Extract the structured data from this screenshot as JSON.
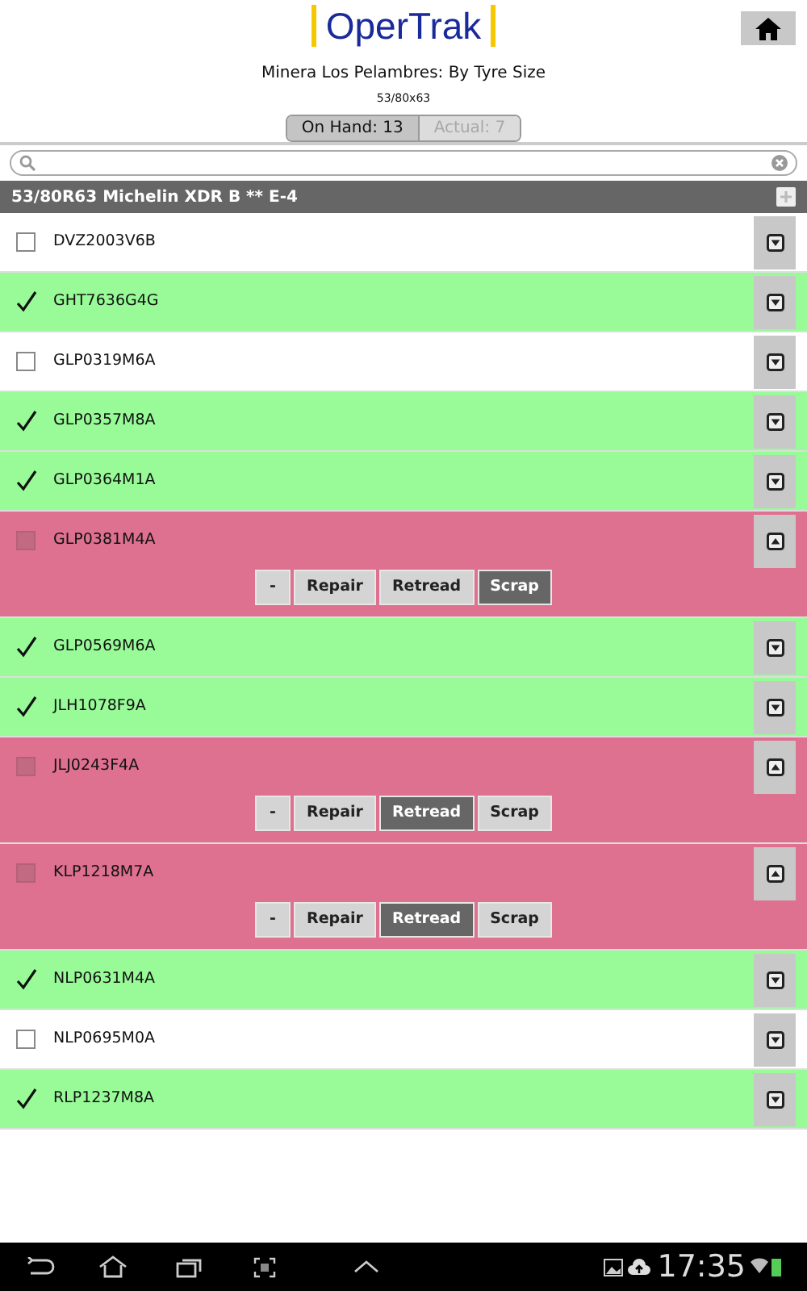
{
  "header": {
    "logo": "OperTrak",
    "title": "Minera Los Pelambres: By Tyre Size",
    "subtitle": "53/80x63"
  },
  "segments": [
    {
      "label": "On Hand: 13",
      "selected": true
    },
    {
      "label": "Actual: 7",
      "selected": false
    }
  ],
  "group": {
    "title": "53/80R63 Michelin XDR B ** E-4"
  },
  "rows": [
    {
      "id": "DVZ2003V6B",
      "kind": "open",
      "expanded": false
    },
    {
      "id": "GHT7636G4G",
      "kind": "done",
      "expanded": false
    },
    {
      "id": "GLP0319M6A",
      "kind": "open",
      "expanded": false
    },
    {
      "id": "GLP0357M8A",
      "kind": "done",
      "expanded": false
    },
    {
      "id": "GLP0364M1A",
      "kind": "done",
      "expanded": false
    },
    {
      "id": "GLP0381M4A",
      "kind": "flagged",
      "expanded": true,
      "actions": [
        {
          "label": "-",
          "selected": false
        },
        {
          "label": "Repair",
          "selected": false
        },
        {
          "label": "Retread",
          "selected": false
        },
        {
          "label": "Scrap",
          "selected": true
        }
      ]
    },
    {
      "id": "GLP0569M6A",
      "kind": "done",
      "expanded": false
    },
    {
      "id": "JLH1078F9A",
      "kind": "done",
      "expanded": false
    },
    {
      "id": "JLJ0243F4A",
      "kind": "flagged",
      "expanded": true,
      "actions": [
        {
          "label": "-",
          "selected": false
        },
        {
          "label": "Repair",
          "selected": false
        },
        {
          "label": "Retread",
          "selected": true
        },
        {
          "label": "Scrap",
          "selected": false
        }
      ]
    },
    {
      "id": "KLP1218M7A",
      "kind": "flagged",
      "expanded": true,
      "actions": [
        {
          "label": "-",
          "selected": false
        },
        {
          "label": "Repair",
          "selected": false
        },
        {
          "label": "Retread",
          "selected": true
        },
        {
          "label": "Scrap",
          "selected": false
        }
      ]
    },
    {
      "id": "NLP0631M4A",
      "kind": "done",
      "expanded": false
    },
    {
      "id": "NLP0695M0A",
      "kind": "open",
      "expanded": false
    },
    {
      "id": "RLP1237M8A",
      "kind": "done",
      "expanded": false
    }
  ],
  "status_bar": {
    "time": "17:35"
  }
}
